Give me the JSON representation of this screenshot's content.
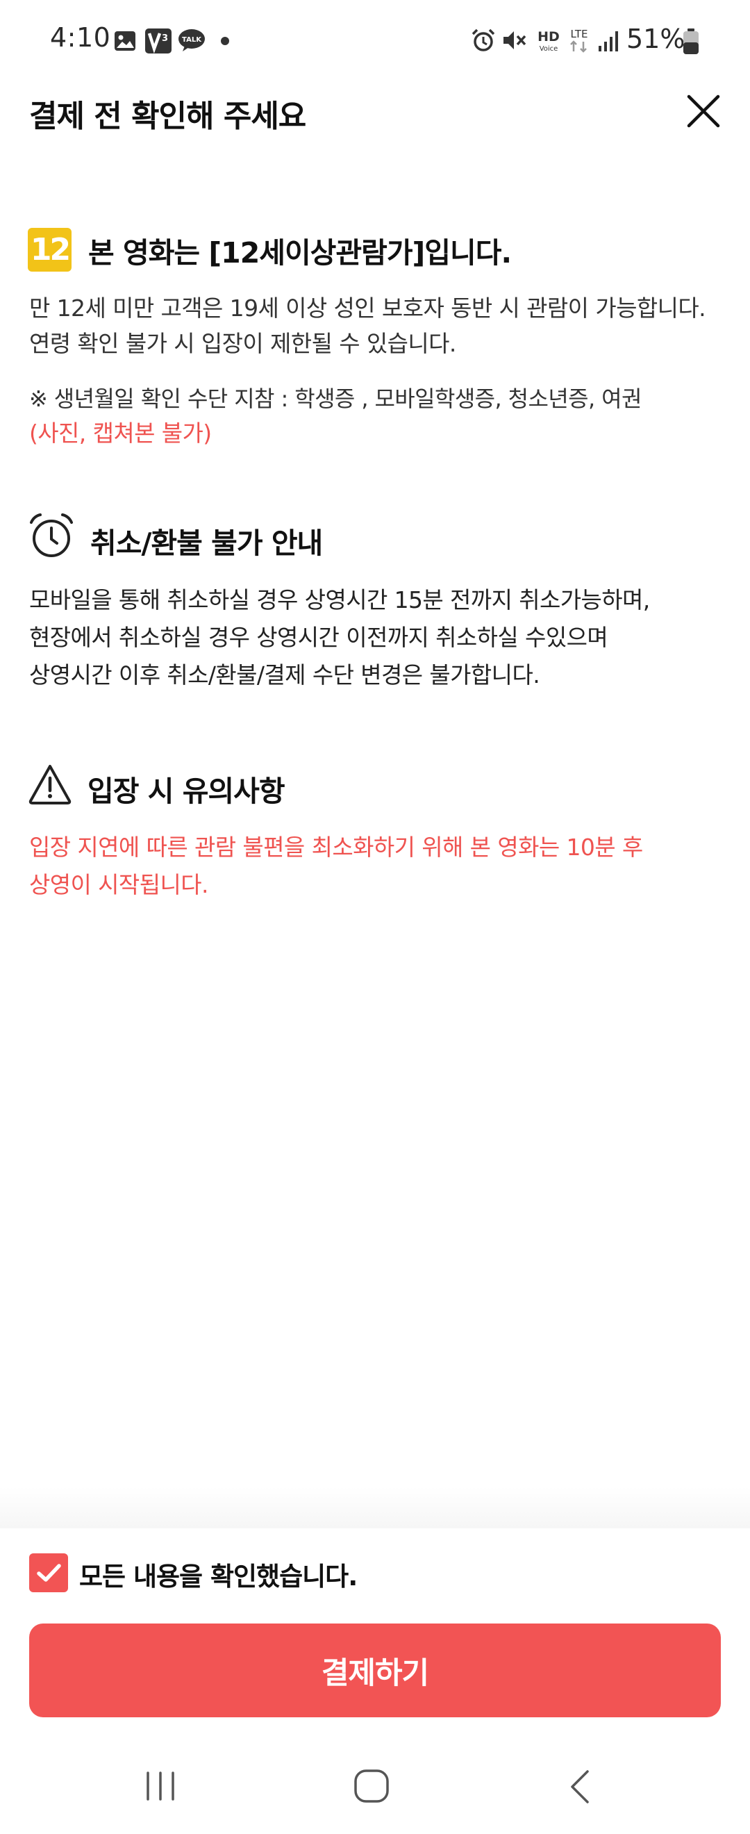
{
  "status_bar": {
    "time": "4:10",
    "battery": "51%",
    "hd_label": "HD",
    "voice_label": "Voice",
    "lte_label": "LTE",
    "talk_label": "TALK"
  },
  "header": {
    "title": "결제 전 확인해 주세요"
  },
  "rating_section": {
    "badge": "12",
    "title": "본 영화는 [12세이상관람가]입니다.",
    "line1": "만 12세 미만 고객은 19세 이상 성인 보호자 동반 시 관람이 가능합니다.",
    "line2": "연령 확인 불가 시 입장이 제한될 수 있습니다.",
    "note": "※ 생년월일 확인 수단 지참 : 학생증 , 모바일학생증, 청소년증, 여권",
    "note_red": "(사진, 캡쳐본 불가)"
  },
  "refund_section": {
    "title": "취소/환불 불가 안내",
    "line1": "모바일을 통해 취소하실 경우 상영시간 15분 전까지 취소가능하며,",
    "line2": "현장에서 취소하실 경우 상영시간 이전까지 취소하실 수있으며",
    "line3": "상영시간 이후 취소/환불/결제 수단 변경은 불가합니다."
  },
  "entry_section": {
    "title": "입장 시 유의사항",
    "line1": "입장 지연에 따른 관람 불편을 최소화하기 위해 본 영화는 10분 후",
    "line2": "상영이 시작됩니다."
  },
  "footer": {
    "confirm_label": "모든 내용을 확인했습니다.",
    "confirm_checked": true,
    "pay_button_label": "결제하기"
  },
  "colors": {
    "accent": "#f25454",
    "warning_text": "#ef5350",
    "age_badge": "#f2c318"
  },
  "icons": {
    "close": "close-icon",
    "age": "age-12-badge",
    "refund": "alarm-clock-icon",
    "entry": "warning-icon",
    "check": "checkmark-icon",
    "nav": [
      "recent-apps-icon",
      "home-icon",
      "back-icon"
    ]
  }
}
